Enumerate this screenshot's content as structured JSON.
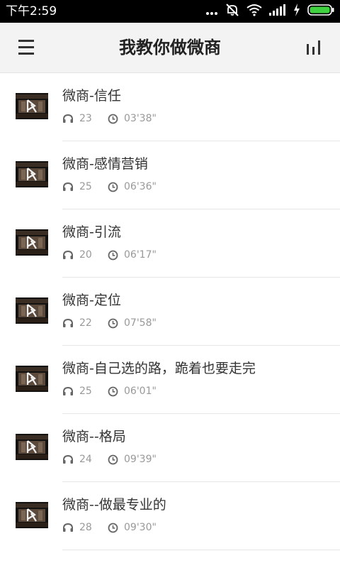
{
  "status_bar": {
    "time": "下午2:59",
    "icons": [
      "more-dots-icon",
      "notifications-off-icon",
      "wifi-icon",
      "signal-icon",
      "charging-icon",
      "battery-icon"
    ]
  },
  "app_bar": {
    "title": "我教你做微商",
    "left_icon": "menu-icon",
    "right_icon": "stats-icon"
  },
  "items": [
    {
      "title": "微商-信任",
      "listens": "23",
      "duration": "03'38\""
    },
    {
      "title": "微商-感情营销",
      "listens": "25",
      "duration": "06'36\""
    },
    {
      "title": "微商-引流",
      "listens": "20",
      "duration": "06'17\""
    },
    {
      "title": "微商-定位",
      "listens": "22",
      "duration": "07'58\""
    },
    {
      "title": "微商-自己选的路，跪着也要走完",
      "listens": "25",
      "duration": "06'01\""
    },
    {
      "title": "微商--格局",
      "listens": "24",
      "duration": "09'39\""
    },
    {
      "title": "微商--做最专业的",
      "listens": "28",
      "duration": "09'30\""
    }
  ],
  "colors": {
    "status_bar_bg": "#000000",
    "app_bar_bg": "#f3f3f3",
    "battery_green": "#3fd13f",
    "text_primary": "#333333",
    "text_secondary": "#999999"
  }
}
